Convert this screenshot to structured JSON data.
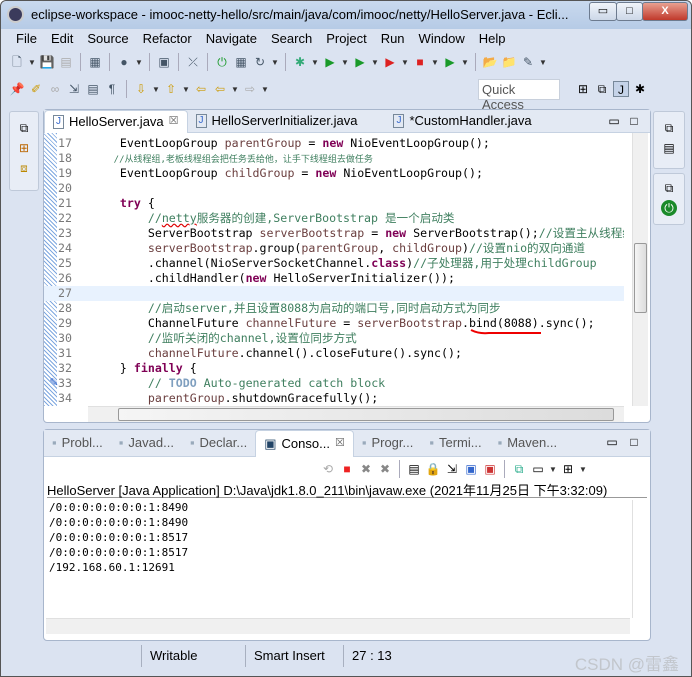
{
  "window": {
    "title": "eclipse-workspace - imooc-netty-hello/src/main/java/com/imooc/netty/HelloServer.java - Ecli...",
    "minimize": "▭",
    "maximize": "□",
    "close": "X"
  },
  "menu": [
    "File",
    "Edit",
    "Source",
    "Refactor",
    "Navigate",
    "Search",
    "Project",
    "Run",
    "Window",
    "Help"
  ],
  "toolbar1": [
    [
      "new-icon",
      "🗋",
      1
    ],
    [
      "save-icon",
      "💾",
      0
    ],
    [
      "save-all-icon",
      "▤",
      0
    ],
    "|",
    [
      "binary-icon",
      "▦",
      0
    ],
    "|",
    [
      "profile-icon",
      "●",
      1
    ],
    "|",
    [
      "console-icon",
      "▣",
      0
    ],
    "|",
    [
      "link-icon",
      "⤫",
      0
    ],
    "|",
    [
      "spring-boot-icon",
      "⏻",
      0
    ],
    [
      "grid-icon",
      "▦",
      0
    ],
    [
      "refresh-icon",
      "↻",
      1
    ],
    "|",
    [
      "debug-icon",
      "✱",
      1
    ],
    [
      "run-icon",
      "▶",
      1
    ],
    [
      "run-coverage-icon",
      "▶",
      1
    ],
    [
      "run-tool-icon",
      "▶",
      1
    ],
    [
      "stop-icon",
      "■",
      1
    ],
    [
      "run-last-icon",
      "▶",
      1
    ],
    "|",
    [
      "open-project-icon",
      "📂",
      0
    ],
    [
      "open-type-icon",
      "📁",
      0
    ],
    [
      "brush-icon",
      "✎",
      1
    ]
  ],
  "toolbar2": [
    [
      "pin-icon",
      "📌",
      0
    ],
    [
      "highlight-icon",
      "✐",
      0
    ],
    [
      "glasses-icon",
      "∞",
      0
    ],
    [
      "toggle-block-icon",
      "⇲",
      0
    ],
    [
      "show-source-icon",
      "▤",
      0
    ],
    [
      "pilcrow-icon",
      "¶",
      0
    ],
    "|",
    [
      "next-annotation-icon",
      "⇩",
      1
    ],
    [
      "prev-annotation-icon",
      "⇧",
      1
    ],
    [
      "last-edit-icon",
      "⇦",
      0
    ],
    [
      "back-icon",
      "⇦",
      1
    ],
    [
      "forward-icon",
      "⇨",
      1
    ]
  ],
  "quick_access": "Quick Access",
  "perspectives": [
    [
      "open-perspective-icon",
      "⊞"
    ],
    [
      "java-ee-icon",
      "⧉"
    ],
    [
      "java-icon",
      "J"
    ],
    [
      "debug-perspective-icon",
      "✱"
    ]
  ],
  "editor": {
    "tabs": [
      {
        "label": "HelloServer.java",
        "close": "☒",
        "active": true
      },
      {
        "label": "HelloServerInitializer.java"
      },
      {
        "label": "*CustomHandler.java"
      }
    ],
    "current_line": 27,
    "lines": [
      {
        "n": "17",
        "s": [
          [
            "    EventLoopGroup ",
            ""
          ],
          [
            "parentGroup",
            "vr"
          ],
          [
            " = ",
            ""
          ],
          [
            "new",
            "kw"
          ],
          [
            " NioEventLoopGroup();",
            ""
          ]
        ]
      },
      {
        "n": "18",
        "s": [
          [
            "    //从线程组,老板线程组会把任务丢给他，让手下线程组去做任务",
            "cn"
          ]
        ]
      },
      {
        "n": "19",
        "s": [
          [
            "    EventLoopGroup ",
            ""
          ],
          [
            "childGroup",
            "vr"
          ],
          [
            " = ",
            ""
          ],
          [
            "new",
            "kw"
          ],
          [
            " NioEventLoopGroup();",
            ""
          ]
        ]
      },
      {
        "n": "20",
        "s": []
      },
      {
        "n": "21",
        "s": [
          [
            "    ",
            ""
          ],
          [
            "try",
            "kw"
          ],
          [
            " {",
            ""
          ]
        ]
      },
      {
        "n": "22",
        "s": [
          [
            "        //",
            "cm"
          ],
          [
            "netty",
            "cm squig"
          ],
          [
            "服务器的创建,ServerBootstrap 是一个启动类",
            "cm"
          ]
        ]
      },
      {
        "n": "23",
        "s": [
          [
            "        ServerBootstrap ",
            ""
          ],
          [
            "serverBootstrap",
            "vr"
          ],
          [
            " = ",
            ""
          ],
          [
            "new",
            "kw"
          ],
          [
            " ServerBootstrap();",
            ""
          ],
          [
            "//设置主从线程组",
            "cm"
          ]
        ]
      },
      {
        "n": "24",
        "s": [
          [
            "        ",
            ""
          ],
          [
            "serverBootstrap",
            "vr"
          ],
          [
            ".group(",
            ""
          ],
          [
            "parentGroup",
            "vr"
          ],
          [
            ", ",
            ""
          ],
          [
            "childGroup",
            "vr"
          ],
          [
            ")",
            ""
          ],
          [
            "//设置nio的双向通道",
            "cm"
          ]
        ]
      },
      {
        "n": "25",
        "s": [
          [
            "        .channel(NioServerSocketChannel.",
            ""
          ],
          [
            "class",
            "kw"
          ],
          [
            ")",
            ""
          ],
          [
            "//子处理器,用于处理childGroup",
            "cm"
          ]
        ]
      },
      {
        "n": "26",
        "s": [
          [
            "        .childHandler(",
            ""
          ],
          [
            "new",
            "kw"
          ],
          [
            " HelloServerInitializer());",
            ""
          ]
        ]
      },
      {
        "n": "27",
        "s": []
      },
      {
        "n": "28",
        "s": [
          [
            "        //启动server,并且设置8088为启动的端口号,同时启动方式为同步",
            "cm"
          ]
        ]
      },
      {
        "n": "29",
        "s": [
          [
            "        ChannelFuture ",
            ""
          ],
          [
            "channelFuture",
            "vr"
          ],
          [
            " = ",
            ""
          ],
          [
            "serverBootstrap",
            "vr"
          ],
          [
            ".bind(8088).sync();",
            ""
          ]
        ]
      },
      {
        "n": "30",
        "s": [
          [
            "        //监听关闭的channel,设置位同步方式",
            "cm"
          ]
        ]
      },
      {
        "n": "31",
        "s": [
          [
            "        ",
            ""
          ],
          [
            "channelFuture",
            "vr"
          ],
          [
            ".channel().closeFuture().sync();",
            ""
          ]
        ]
      },
      {
        "n": "32",
        "s": [
          [
            "    } ",
            ""
          ],
          [
            "finally",
            "kw"
          ],
          [
            " {",
            ""
          ]
        ]
      },
      {
        "n": "33",
        "s": [
          [
            "        // ",
            "cm"
          ],
          [
            "TODO",
            "todo"
          ],
          [
            " Auto-generated catch block",
            "cm"
          ]
        ]
      },
      {
        "n": "34",
        "s": [
          [
            "        ",
            ""
          ],
          [
            "parentGroup",
            "vr"
          ],
          [
            ".shutdownGracefully();",
            ""
          ]
        ]
      }
    ]
  },
  "bottom": {
    "tabs": [
      {
        "label": "Probl...",
        "icon": "problems-icon"
      },
      {
        "label": "Javad...",
        "icon": "javadoc-icon"
      },
      {
        "label": "Declar...",
        "icon": "declaration-icon"
      },
      {
        "label": "Conso...",
        "icon": "console-icon",
        "active": true,
        "close": "☒"
      },
      {
        "label": "Progr...",
        "icon": "progress-icon"
      },
      {
        "label": "Termi...",
        "icon": "terminal-icon"
      },
      {
        "label": "Maven...",
        "icon": "maven-icon"
      }
    ],
    "header": "HelloServer [Java Application] D:\\Java\\jdk1.8.0_211\\bin\\javaw.exe (2021年11月25日 下午3:32:09)",
    "output": [
      "/0:0:0:0:0:0:0:1:8490",
      "/0:0:0:0:0:0:0:1:8490",
      "/0:0:0:0:0:0:0:1:8517",
      "/0:0:0:0:0:0:0:1:8517",
      "/192.168.60.1:12691"
    ]
  },
  "status": {
    "writable": "Writable",
    "insert_mode": "Smart Insert",
    "position": "27 : 13"
  },
  "watermark": "CSDN @雷鑫",
  "colors": {
    "keyword": "#7f0055",
    "comment": "#3f7f5f",
    "variable": "#6a3e3e",
    "annotation_underline": "#d00000"
  }
}
